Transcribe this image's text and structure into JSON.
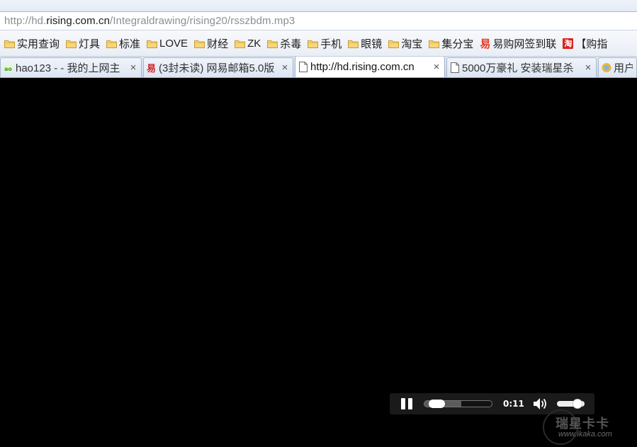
{
  "address_bar": {
    "url_prefix": "http://hd.",
    "url_host": "rising.com.cn",
    "url_path": "/Integraldrawing/rising20/rsszbdm.mp3"
  },
  "bookmarks": [
    {
      "label": "实用查询",
      "icon": "folder-icon"
    },
    {
      "label": "灯具",
      "icon": "folder-icon"
    },
    {
      "label": "标准",
      "icon": "folder-icon"
    },
    {
      "label": "LOVE",
      "icon": "folder-icon"
    },
    {
      "label": "财经",
      "icon": "folder-icon"
    },
    {
      "label": "ZK",
      "icon": "folder-icon"
    },
    {
      "label": "杀毒",
      "icon": "folder-icon"
    },
    {
      "label": "手机",
      "icon": "folder-icon"
    },
    {
      "label": "眼镜",
      "icon": "folder-icon"
    },
    {
      "label": "淘宝",
      "icon": "folder-icon"
    },
    {
      "label": "集分宝",
      "icon": "folder-icon"
    },
    {
      "label": "易购网签到联",
      "icon": "yigou-icon",
      "icon_glyph": "易"
    },
    {
      "label": "【购指",
      "icon": "taobao-icon",
      "icon_glyph": "淘"
    }
  ],
  "tabs": [
    {
      "title": "hao123 - ‐ 我的上网主",
      "icon": "hao123-icon",
      "active": false,
      "close": "×"
    },
    {
      "title": "(3封未读) 网易邮箱5.0版",
      "icon": "netease-icon",
      "active": false,
      "close": "×"
    },
    {
      "title": "http://hd.rising.com.cn",
      "icon": "page-icon",
      "active": true,
      "close": "×"
    },
    {
      "title": "5000万豪礼 安装瑞星杀",
      "icon": "page-icon",
      "active": false,
      "close": "×"
    },
    {
      "title": "用户",
      "icon": "user-icon",
      "active": false
    }
  ],
  "player": {
    "state": "playing",
    "time": "0:11",
    "progress": 0.1,
    "buffered": 0.55,
    "volume": 0.85
  },
  "watermark": {
    "title": "瑞星卡卡",
    "url": "www.ikaka.com"
  },
  "colors": {
    "page_background": "#000000",
    "player_background": "#1a1a1a",
    "url_host": "#1a1a1a",
    "url_dim": "#8a8f96"
  }
}
